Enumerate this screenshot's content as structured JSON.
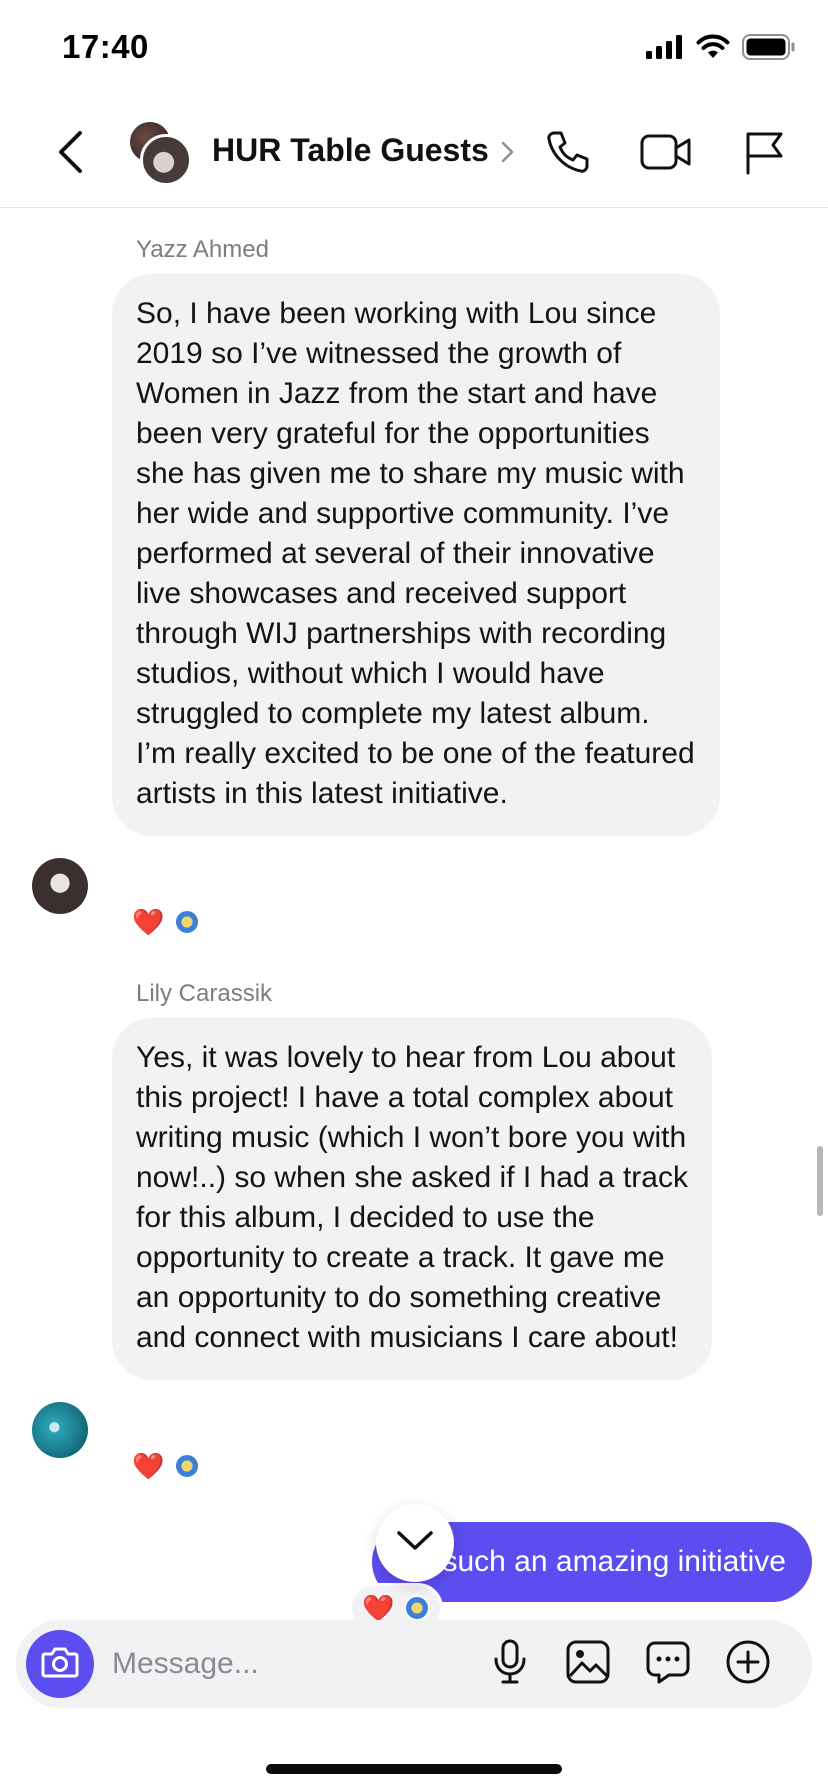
{
  "status_bar": {
    "time": "17:40"
  },
  "header": {
    "title": "HUR Table Guests"
  },
  "messages": [
    {
      "sender": "Yazz Ahmed",
      "text": "So, I have been working with Lou since 2019 so I’ve witnessed the growth of Women in Jazz from the start and have been very grateful for the opportunities she has given me to share my music with her wide and supportive community. I’ve performed at several of their innovative live showcases and received support through WIJ partnerships with recording studios, without which I would have struggled to complete my latest album. I’m really excited to be one of the featured artists in this latest initiative.",
      "reactions": [
        "heart",
        "badge"
      ]
    },
    {
      "sender": "Lily Carassik",
      "text": "Yes, it was lovely to hear from Lou about this project! I have a total complex about writing music (which I won’t bore you with now!..) so when she asked if I had a track for this album, I decided to use the opportunity to create a track. It gave me an opportunity to do something creative and connect with musicians I care about!",
      "reactions": [
        "heart",
        "badge"
      ]
    }
  ],
  "outgoing": {
    "text": "It’s such an amazing initiative",
    "reactions": [
      "heart",
      "badge"
    ]
  },
  "composer": {
    "placeholder": "Message..."
  },
  "icons": {
    "reaction_heart": "❤️",
    "back": "chevron-left-icon",
    "call": "phone-icon",
    "video": "video-icon",
    "report": "flag-icon",
    "camera": "camera-icon",
    "mic": "microphone-icon",
    "gallery": "image-icon",
    "sticker": "chat-bubble-icon",
    "more": "plus-circle-icon"
  },
  "colors": {
    "accent": "#5b4df0",
    "bubble_incoming": "#f2f2f4",
    "heart": "#e0242b"
  }
}
